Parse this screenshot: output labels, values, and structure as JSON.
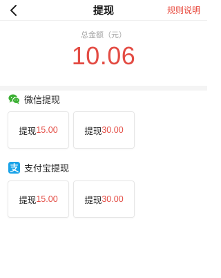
{
  "header": {
    "back_icon": "chevron-left-icon",
    "title": "提现",
    "rules_link": "规则说明"
  },
  "summary": {
    "label": "总金额（元）",
    "amount": "10.06"
  },
  "wechat": {
    "icon": "wechat-icon",
    "title": "微信提现",
    "options": [
      {
        "label": "提现",
        "amount": "15.00"
      },
      {
        "label": "提现",
        "amount": "30.00"
      }
    ]
  },
  "alipay": {
    "icon": "alipay-icon",
    "title": "支付宝提现",
    "options": [
      {
        "label": "提现",
        "amount": "15.00"
      },
      {
        "label": "提现",
        "amount": "30.00"
      }
    ]
  },
  "colors": {
    "accent_red": "#e34b43",
    "wechat_green": "#3cb034",
    "alipay_blue": "#1aa3e8"
  }
}
